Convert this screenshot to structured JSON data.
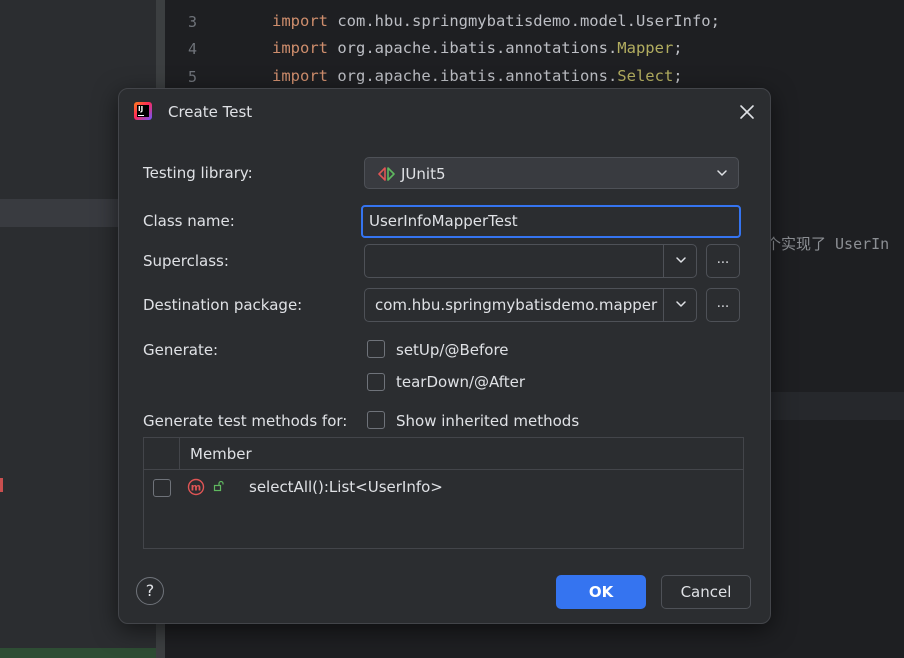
{
  "editor": {
    "lines": [
      {
        "number": "3",
        "keyword": "import",
        "path": " com.hbu.springmybatisdemo.model.UserInfo",
        "annotation": "",
        "end": ";"
      },
      {
        "number": "4",
        "keyword": "import",
        "path": " org.apache.ibatis.annotations.",
        "annotation": "Mapper",
        "end": ";"
      },
      {
        "number": "5",
        "keyword": "import",
        "path": " org.apache.ibatis.annotations.",
        "annotation": "Select",
        "end": ";"
      }
    ],
    "side_text": "个实现了 UserIn"
  },
  "dialog": {
    "title": "Create Test",
    "testing_library": {
      "label": "Testing library:",
      "value": "JUnit5"
    },
    "class_name": {
      "label": "Class name:",
      "value": "UserInfoMapperTest"
    },
    "superclass": {
      "label": "Superclass:",
      "value": ""
    },
    "destination_package": {
      "label": "Destination package:",
      "value": "com.hbu.springmybatisdemo.mapper"
    },
    "browse_label": "...",
    "generate": {
      "label": "Generate:",
      "options": [
        {
          "label": "setUp/@Before",
          "checked": false
        },
        {
          "label": "tearDown/@After",
          "checked": false
        }
      ]
    },
    "methods": {
      "label": "Generate test methods for:",
      "show_inherited_label": "Show inherited methods",
      "column_member": "Member",
      "rows": [
        {
          "method": "selectAll():List<UserInfo>",
          "checked": false
        }
      ]
    },
    "help_label": "?",
    "ok_label": "OK",
    "cancel_label": "Cancel"
  },
  "colors": {
    "accent": "#3574f0",
    "keyword": "#cf8e6d",
    "annotation": "#b3ae60",
    "method_icon": "#e05555",
    "public_icon": "#5fb85f"
  }
}
